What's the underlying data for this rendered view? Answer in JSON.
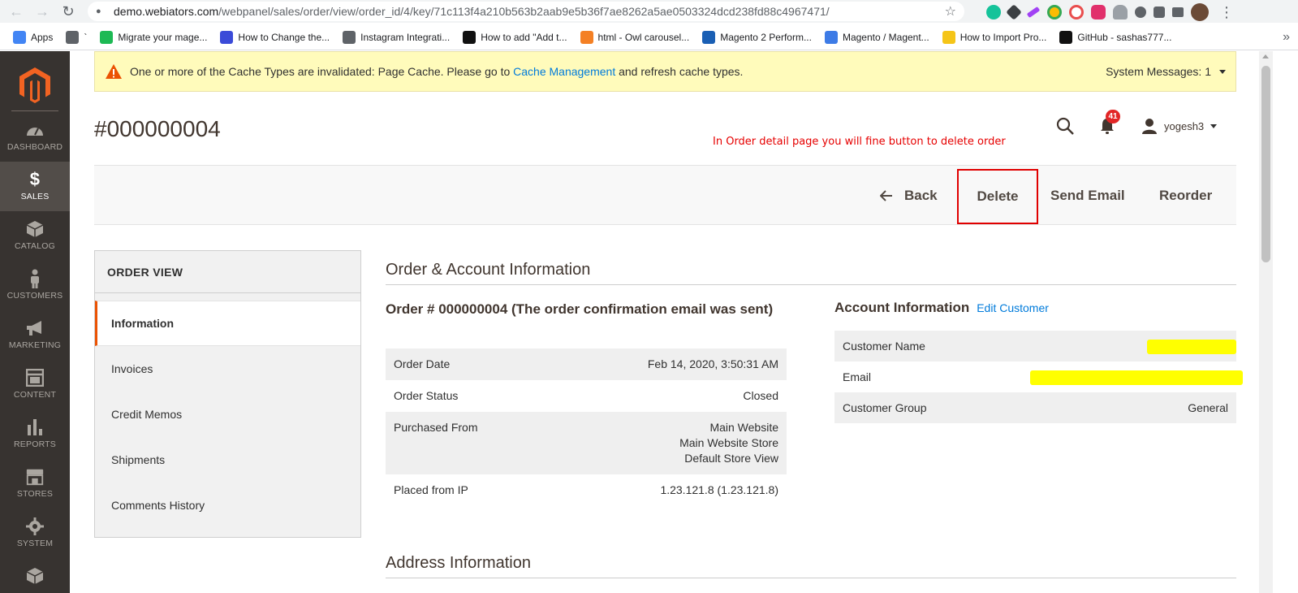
{
  "browser": {
    "url_host": "demo.webiators.com",
    "url_path": "/webpanel/sales/order/view/order_id/4/key/71c113f4a210b563b2aab9e5b36f7ae8262a5ae0503324dcd238fd88c4967471/",
    "bookmarks": [
      {
        "label": "Apps",
        "icon": "apps-grid-icon",
        "color": "#4285f4"
      },
      {
        "label": "`",
        "icon": "globe-icon",
        "color": "#5f6368"
      },
      {
        "label": "Migrate your mage...",
        "icon": "migrate-icon",
        "color": "#1db954"
      },
      {
        "label": "How to Change the...",
        "icon": "plane-icon",
        "color": "#3b4bd8"
      },
      {
        "label": "Instagram Integrati...",
        "icon": "globe-icon",
        "color": "#5f6368"
      },
      {
        "label": "How to add \"Add t...",
        "icon": "medium-icon",
        "color": "#111111"
      },
      {
        "label": "html - Owl carousel...",
        "icon": "stackoverflow-icon",
        "color": "#f48024"
      },
      {
        "label": "Magento 2 Perform...",
        "icon": "magento-blue-icon",
        "color": "#1a5fb4"
      },
      {
        "label": "Magento / Magent...",
        "icon": "c-icon",
        "color": "#3d7be6"
      },
      {
        "label": "How to Import Pro...",
        "icon": "hand-icon",
        "color": "#f5c518"
      },
      {
        "label": "GitHub - sashas777...",
        "icon": "github-icon",
        "color": "#111111"
      }
    ]
  },
  "sidebar": {
    "items": [
      {
        "label": "DASHBOARD",
        "icon": "dashboard-icon"
      },
      {
        "label": "SALES",
        "icon": "dollar-icon"
      },
      {
        "label": "CATALOG",
        "icon": "box-icon"
      },
      {
        "label": "CUSTOMERS",
        "icon": "person-icon"
      },
      {
        "label": "MARKETING",
        "icon": "megaphone-icon"
      },
      {
        "label": "CONTENT",
        "icon": "layout-icon"
      },
      {
        "label": "REPORTS",
        "icon": "bar-chart-icon"
      },
      {
        "label": "STORES",
        "icon": "store-icon"
      },
      {
        "label": "SYSTEM",
        "icon": "gear-icon"
      }
    ]
  },
  "system_message": {
    "text_before": "One or more of the Cache Types are invalidated: Page Cache. Please go to ",
    "link": "Cache Management",
    "text_after": " and refresh cache types.",
    "count_label": "System Messages: 1"
  },
  "header": {
    "title": "#000000004",
    "annotation": "In Order detail page you will fine button to delete order",
    "notification_count": "41",
    "username": "yogesh3"
  },
  "actions": {
    "back": "Back",
    "delete": "Delete",
    "send_email": "Send Email",
    "reorder": "Reorder"
  },
  "tabs": {
    "title": "ORDER VIEW",
    "items": [
      "Information",
      "Invoices",
      "Credit Memos",
      "Shipments",
      "Comments History"
    ]
  },
  "order_account": {
    "section_title": "Order & Account Information",
    "order_heading": "Order # 000000004 (The order confirmation email was sent)",
    "order_rows": [
      {
        "label": "Order Date",
        "value": "Feb 14, 2020, 3:50:31 AM"
      },
      {
        "label": "Order Status",
        "value": "Closed"
      },
      {
        "label": "Purchased From",
        "value_lines": [
          "Main Website",
          "Main Website Store",
          "Default Store View"
        ]
      },
      {
        "label": "Placed from IP",
        "value": "1.23.121.8 (1.23.121.8)"
      }
    ],
    "account_heading": "Account Information",
    "edit_customer": "Edit Customer",
    "account_rows": [
      {
        "label": "Customer Name",
        "value": ""
      },
      {
        "label": "Email",
        "value": ""
      },
      {
        "label": "Customer Group",
        "value": "General"
      }
    ]
  },
  "address": {
    "section_title": "Address Information"
  }
}
